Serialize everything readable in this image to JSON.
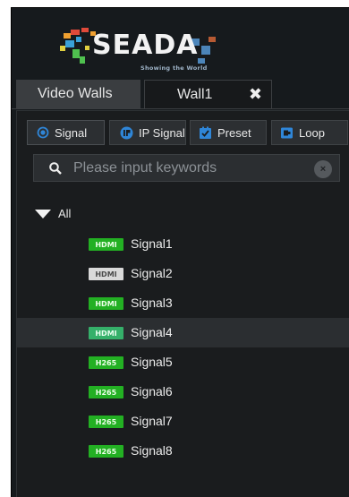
{
  "logo": {
    "text": "SEADA",
    "tagline": "Showing the World"
  },
  "tabs": [
    {
      "label": "Video Walls",
      "active": false
    },
    {
      "label": "Wall1",
      "active": true,
      "closable": true
    }
  ],
  "close_icon": "✖",
  "subtabs": [
    {
      "label": "Signal",
      "icon": "radio-icon"
    },
    {
      "label": "IP Signal",
      "icon": "ip-icon"
    },
    {
      "label": "Preset",
      "icon": "preset-checkbox-icon"
    },
    {
      "label": "Loop",
      "icon": "loop-icon"
    }
  ],
  "search": {
    "placeholder": "Please input keywords",
    "value": "",
    "clear_glyph": "×"
  },
  "tree": {
    "root_label": "All",
    "items": [
      {
        "badge": "HDMI",
        "label": "Signal1",
        "badge_state": "on",
        "selected": false
      },
      {
        "badge": "HDMI",
        "label": "Signal2",
        "badge_state": "off",
        "selected": false
      },
      {
        "badge": "HDMI",
        "label": "Signal3",
        "badge_state": "on",
        "selected": false
      },
      {
        "badge": "HDMI",
        "label": "Signal4",
        "badge_state": "sel",
        "selected": true
      },
      {
        "badge": "H265",
        "label": "Signal5",
        "badge_state": "on",
        "selected": false
      },
      {
        "badge": "H265",
        "label": "Signal6",
        "badge_state": "on",
        "selected": false
      },
      {
        "badge": "H265",
        "label": "Signal7",
        "badge_state": "on",
        "selected": false
      },
      {
        "badge": "H265",
        "label": "Signal8",
        "badge_state": "on",
        "selected": false
      }
    ]
  },
  "colors": {
    "background": "#161a1d",
    "accent_blue": "#2f86d8",
    "badge_green": "#23b023",
    "badge_gray": "#d9d9d9",
    "badge_selected": "#35b06a"
  }
}
